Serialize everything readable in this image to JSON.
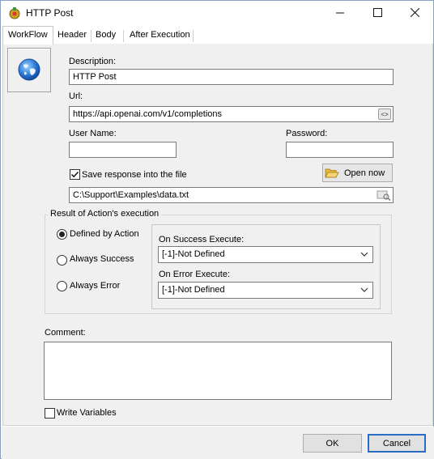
{
  "window": {
    "title": "HTTP Post"
  },
  "tabs": [
    {
      "label": "WorkFlow"
    },
    {
      "label": "Header"
    },
    {
      "label": "Body"
    },
    {
      "label": "After Execution"
    }
  ],
  "form": {
    "description_label": "Description:",
    "description_value": "HTTP Post",
    "url_label": "Url:",
    "url_value": "https://api.openai.com/v1/completions",
    "username_label": "User Name:",
    "username_value": "",
    "password_label": "Password:",
    "password_value": "",
    "save_response_label": "Save response into the file",
    "save_response_checked": true,
    "open_now_label": "Open now",
    "file_path_value": "C:\\Support\\Examples\\data.txt"
  },
  "result_group": {
    "title": "Result of Action's execution",
    "options": [
      {
        "label": "Defined by  Action",
        "selected": true
      },
      {
        "label": "Always Success",
        "selected": false
      },
      {
        "label": "Always Error",
        "selected": false
      }
    ],
    "on_success_label": "On Success Execute:",
    "on_success_value": "[-1]-Not Defined",
    "on_error_label": "On Error Execute:",
    "on_error_value": "[-1]-Not Defined"
  },
  "comment": {
    "label": "Comment:",
    "value": ""
  },
  "write_variables": {
    "label": "Write Variables",
    "checked": false
  },
  "footer": {
    "ok_label": "OK",
    "cancel_label": "Cancel"
  },
  "icons": {
    "app": "gear-app-icon",
    "globe": "globe-icon",
    "minimize": "minimize-icon",
    "maximize": "maximize-icon",
    "close": "close-icon",
    "folder": "folder-open-icon",
    "url_edit": "code-brackets-icon",
    "file_browse": "browse-icon",
    "dropdown": "chevron-down-icon"
  },
  "colors": {
    "accent": "#2b6cc4",
    "panel_bg": "#f0f0f0",
    "button_bg": "#e1e1e1"
  }
}
